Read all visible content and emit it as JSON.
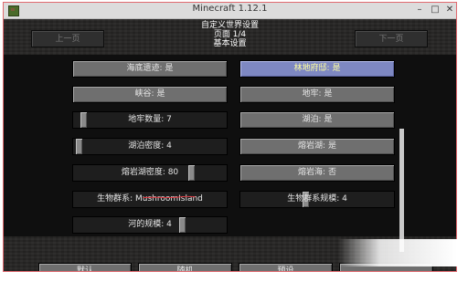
{
  "window": {
    "title": "Minecraft 1.12.1"
  },
  "header": {
    "line1": "自定义世界设置",
    "line2": "页面 1/4",
    "line3": "基本设置"
  },
  "nav": {
    "prev": "上一页",
    "next": "下一页"
  },
  "left_col": [
    {
      "label": "海底遗迹: 是"
    },
    {
      "label": "峡谷: 是"
    },
    {
      "label": "地牢数量: 7",
      "slider": 0.05
    },
    {
      "label": "湖泊密度: 4",
      "slider": 0.02
    },
    {
      "label": "熔岩湖密度: 80",
      "slider": 0.78
    },
    {
      "label": "生物群系: MushroomIsland"
    },
    {
      "label": "河的规模: 4",
      "slider": 0.72
    }
  ],
  "right_col": [
    {
      "label": "林地府邸: 是",
      "highlighted": true
    },
    {
      "label": "地牢: 是"
    },
    {
      "label": "湖泊: 是"
    },
    {
      "label": "熔岩湖: 是"
    },
    {
      "label": "熔岩海: 否"
    },
    {
      "label": "生物群系规模: 4",
      "slider": 0.42
    }
  ],
  "footer": {
    "defaults": "默认",
    "random": "随机",
    "presets": "预设"
  },
  "colors": {
    "highlight": "#7e88c2",
    "underline": "#e0343c"
  }
}
